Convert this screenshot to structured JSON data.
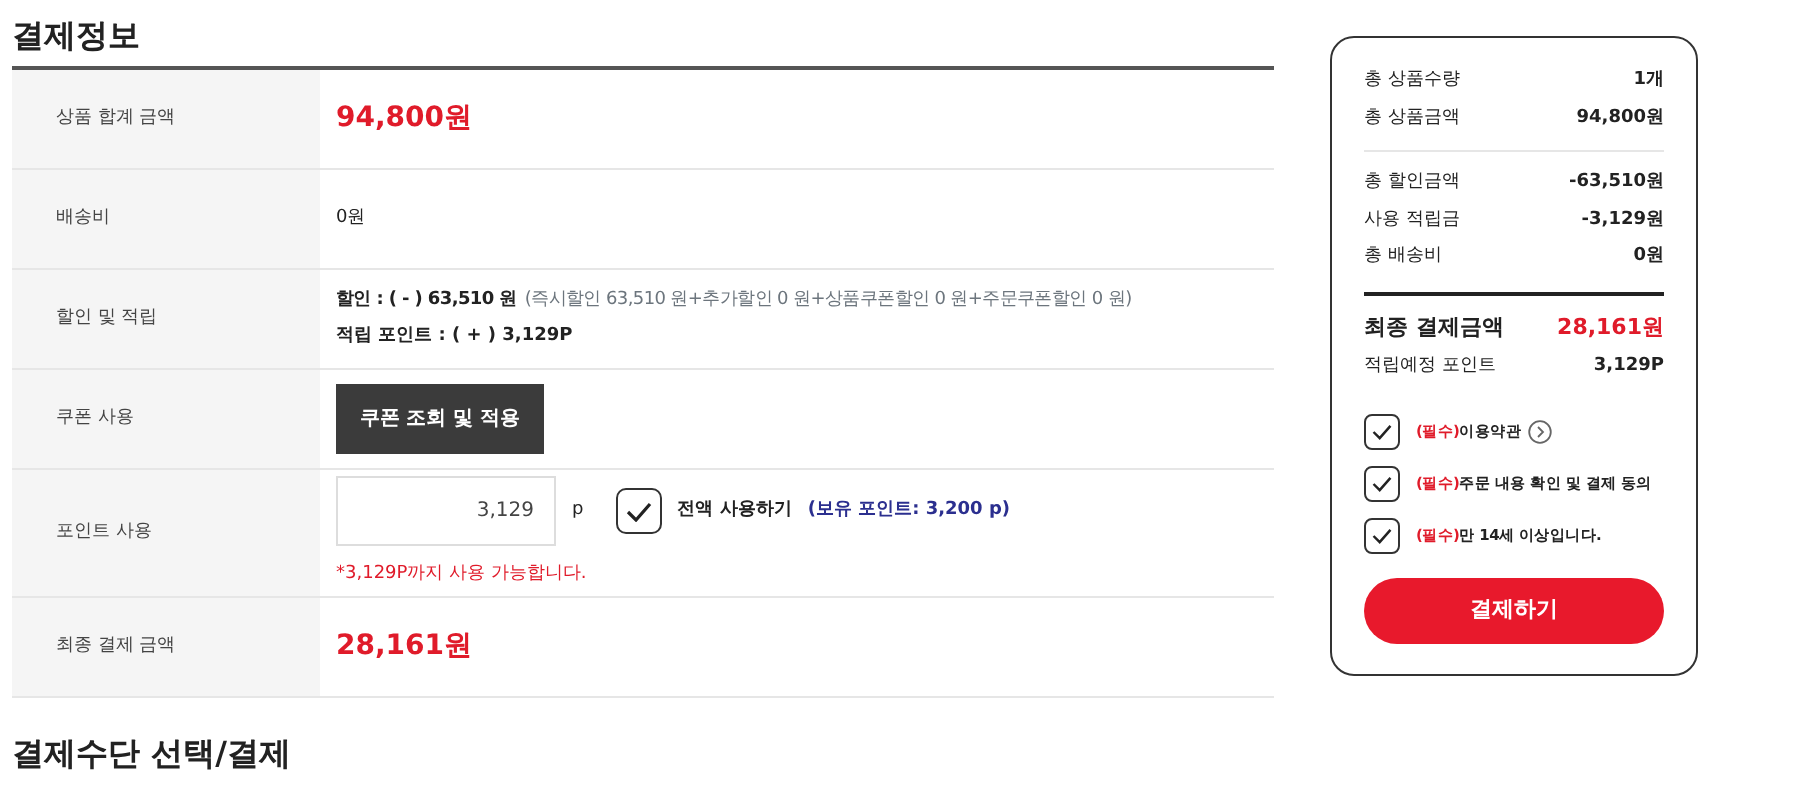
{
  "payment_info": {
    "title": "결제정보",
    "rows": [
      {
        "kind": "amount",
        "label": "상품 합계 금액",
        "value": "94,800원"
      },
      {
        "kind": "text",
        "label": "배송비",
        "value": "0원"
      },
      {
        "kind": "discount",
        "label": "할인 및 적립",
        "discount": "할인 : ( - ) 63,510 원",
        "detail": "(즉시할인 63,510 원+추가할인 0 원+상품쿠폰할인 0 원+주문쿠폰할인 0 원)",
        "points": "적립 포인트 : ( + ) 3,129P"
      },
      {
        "kind": "button",
        "label": "쿠폰 사용",
        "button": "쿠폰 조회 및 적용"
      },
      {
        "kind": "points",
        "label": "포인트 사용",
        "value": "3,129",
        "unit": "p",
        "checked": true,
        "check_label": "전액 사용하기",
        "balance": "(보유 포인트: 3,200 p)",
        "note": "*3,129P까지 사용 가능합니다."
      },
      {
        "kind": "amount",
        "label": "최종 결제 금액",
        "value": "28,161원"
      }
    ]
  },
  "summary": {
    "groups": [
      [
        {
          "label": "총 상품수량",
          "value": "1개"
        },
        {
          "label": "총 상품금액",
          "value": "94,800원"
        }
      ],
      [
        {
          "label": "총 할인금액",
          "value": "-63,510원"
        },
        {
          "label": "사용 적립금",
          "value": "-3,129원"
        },
        {
          "label": "총 배송비",
          "value": "0원"
        }
      ]
    ],
    "final": {
      "label": "최종 결제금액",
      "value": "28,161원"
    },
    "earn": {
      "label": "적립예정 포인트",
      "value": "3,129P"
    },
    "agreements": [
      {
        "required": "(필수)",
        "text": "이용약관",
        "checked": true,
        "has_link": true
      },
      {
        "required": "(필수)",
        "text": "주문 내용 확인 및 결제 동의",
        "checked": true,
        "has_link": false
      },
      {
        "required": "(필수)",
        "text": "만 14세 이상입니다.",
        "checked": true,
        "has_link": false
      }
    ],
    "button": "결제하기"
  },
  "payment_method": {
    "title": "결제수단 선택/결제"
  }
}
